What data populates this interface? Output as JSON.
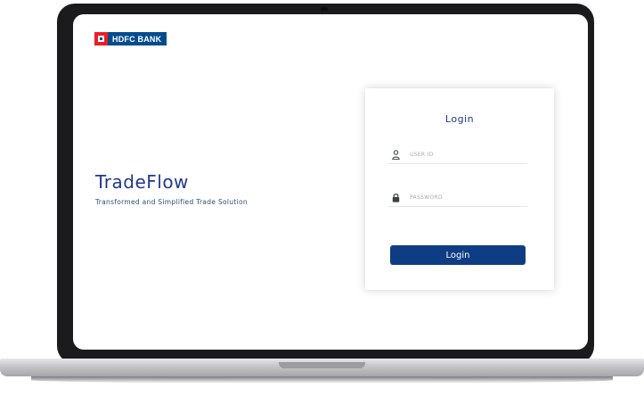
{
  "brand": {
    "logo_text": "HDFC BANK",
    "app_name": "TradeFlow",
    "tagline": "Transformed and Simplified Trade Solution"
  },
  "login": {
    "heading": "Login",
    "user_id_placeholder": "USER ID",
    "password_placeholder": "PASSWORD",
    "button_label": "Login"
  },
  "colors": {
    "brand_red": "#ed1c24",
    "brand_blue": "#004c8f",
    "primary_button": "#0f3d84",
    "title_blue": "#1f3a8a"
  },
  "icons": {
    "user_field": "user-icon",
    "password_field": "lock-icon"
  }
}
